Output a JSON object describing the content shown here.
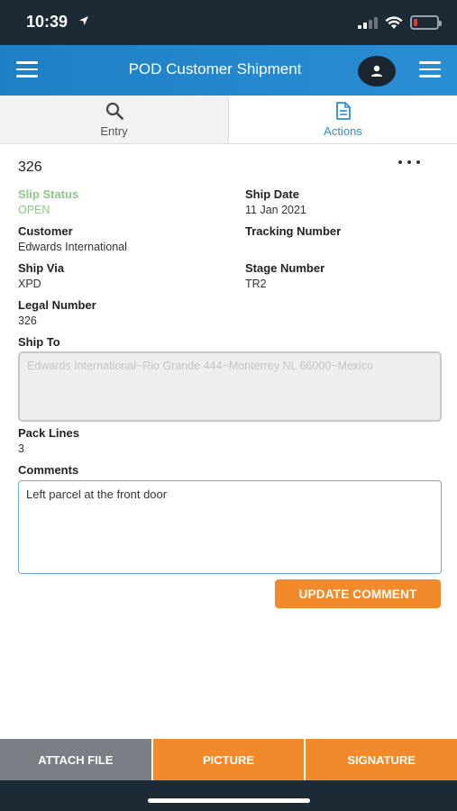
{
  "status_bar": {
    "time": "10:39",
    "battery_level": 0.15
  },
  "header": {
    "title": "POD Customer Shipment",
    "menu_icon": "hamburger-icon",
    "avatar_icon": "user-icon"
  },
  "tabs": [
    {
      "label": "Entry",
      "icon": "search-icon",
      "active": false
    },
    {
      "label": "Actions",
      "icon": "document-icon",
      "active": true
    }
  ],
  "slip": {
    "number": "326",
    "more_icon": "more-horizontal-icon"
  },
  "fields": {
    "slip_status": {
      "label": "Slip Status",
      "value": "OPEN"
    },
    "ship_date": {
      "label": "Ship Date",
      "value": "11 Jan 2021"
    },
    "customer": {
      "label": "Customer",
      "value": "Edwards International"
    },
    "tracking_number": {
      "label": "Tracking Number",
      "value": ""
    },
    "ship_via": {
      "label": "Ship Via",
      "value": "XPD"
    },
    "stage_number": {
      "label": "Stage Number",
      "value": "TR2"
    },
    "legal_number": {
      "label": "Legal Number",
      "value": "326"
    },
    "ship_to": {
      "label": "Ship To",
      "value": "Edwards International~Rio Grande 444~Monterrey NL 66000~Mexico"
    },
    "pack_lines": {
      "label": "Pack Lines",
      "value": "3"
    },
    "comments": {
      "label": "Comments",
      "value": "Left parcel at the front door"
    }
  },
  "buttons": {
    "update_comment": "UPDATE COMMENT",
    "attach_file": "ATTACH FILE",
    "picture": "PICTURE",
    "signature": "SIGNATURE"
  },
  "colors": {
    "header_blue": "#2a8ed4",
    "status_green": "#8bc88a",
    "action_orange": "#f28a2c",
    "attach_gray": "#7a7f85",
    "dark_bar": "#1c2a36"
  }
}
